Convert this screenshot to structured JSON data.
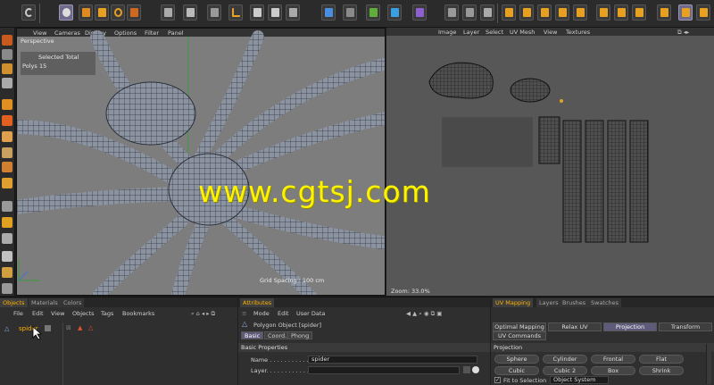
{
  "viewport": {
    "menu": [
      "View",
      "Cameras",
      "Display",
      "Options",
      "Filter",
      "Panel"
    ],
    "camera": "Perspective",
    "info_header": "Selected Total",
    "polys_label": "Polys",
    "polys_value": "15",
    "grid_spacing": "Grid Spacing : 100 cm"
  },
  "uv_view": {
    "menu": [
      "Image",
      "Layer",
      "Select",
      "UV Mesh",
      "View",
      "Textures"
    ],
    "zoom": "Zoom: 33.0%"
  },
  "watermark": "www.cgtsj.com",
  "objects_panel": {
    "tabs": [
      "Objects",
      "Materials",
      "Colors"
    ],
    "menu": [
      "File",
      "Edit",
      "View",
      "Objects",
      "Tags",
      "Bookmarks"
    ],
    "object_name": "spider"
  },
  "attributes_panel": {
    "tab": "Attributes",
    "menu": [
      "Mode",
      "Edit",
      "User Data"
    ],
    "object_title": "Polygon Object [spider]",
    "subtabs": [
      "Basic",
      "Coord.",
      "Phong"
    ],
    "section": "Basic Properties",
    "name_label": "Name . . . . . . . . . . . .",
    "name_value": "spider",
    "layer_label": "Layer. . . . . . . . . . . ."
  },
  "uv_mapping_panel": {
    "tabs": [
      "UV Mapping",
      "Layers",
      "Brushes",
      "Swatches"
    ],
    "mode_tabs": [
      "Optimal Mapping",
      "Relax UV",
      "Projection",
      "Transform",
      "UV Commands"
    ],
    "section": "Projection",
    "buttons_row1": [
      "Sphere",
      "Cylinder",
      "Frontal",
      "Flat"
    ],
    "buttons_row2": [
      "Cubic",
      "Cubic 2",
      "Box",
      "Shrink"
    ],
    "fit_label": "Fit to Selection",
    "system_value": "Object System"
  },
  "colors": {
    "accent_tab": "#ffb200",
    "selected_button": "#6f6a8a",
    "viewport_bg": "#7d7d7d",
    "uv_bg": "#575757",
    "watermark": "#fff200"
  }
}
